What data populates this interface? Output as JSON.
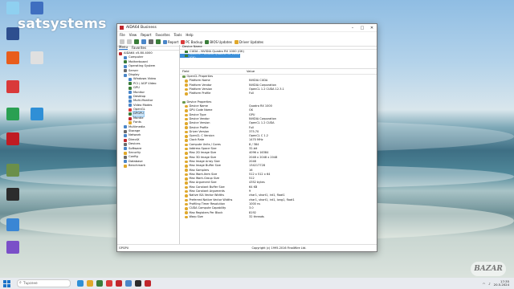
{
  "desktop": {
    "watermark": "satsystems",
    "badge": "BAZAR",
    "icons": [
      {
        "label": "",
        "color": "#8fd0f0"
      },
      {
        "label": "",
        "color": "#3f6fc0"
      },
      {
        "label": "",
        "color": "#2e4f8f"
      },
      {
        "label": "",
        "color": "#e85d1c"
      },
      {
        "label": "",
        "color": "#e0e0e0"
      },
      {
        "label": "",
        "color": "#d93a3a"
      },
      {
        "label": "",
        "color": "#2aa052"
      },
      {
        "label": "",
        "color": "#2f8fd6"
      },
      {
        "label": "",
        "color": "#c01b22"
      },
      {
        "label": "",
        "color": "#6b8f4a"
      },
      {
        "label": "",
        "color": "#2c2c2c"
      },
      {
        "label": "",
        "color": "#3a86d4"
      },
      {
        "label": "",
        "color": "#7a4fc8"
      }
    ]
  },
  "window": {
    "title": "AIDA64 Business",
    "menu": [
      "File",
      "View",
      "Report",
      "Favorites",
      "Tools",
      "Help"
    ],
    "toolbar": {
      "report": "Report",
      "pc_backup": "PC Backup",
      "bios_updates": "BIOS Updates",
      "driver_updates": "Driver Updates"
    },
    "tabs": [
      "Menu",
      "Favorites"
    ],
    "tree": [
      {
        "label": "AIDA64 v5.80.4000",
        "indent": 0,
        "color": "#c0262c"
      },
      {
        "label": "Computer",
        "indent": 1,
        "color": "#4a86c8"
      },
      {
        "label": "Motherboard",
        "indent": 1,
        "color": "#3a7d3a"
      },
      {
        "label": "Operating System",
        "indent": 1,
        "color": "#4a86c8"
      },
      {
        "label": "Server",
        "indent": 1,
        "color": "#6a6a6a"
      },
      {
        "label": "Display",
        "indent": 1,
        "color": "#4a86c8"
      },
      {
        "label": "Windows Video",
        "indent": 2,
        "color": "#4a86c8"
      },
      {
        "label": "PCI / AGP Video",
        "indent": 2,
        "color": "#3a7d3a"
      },
      {
        "label": "GPU",
        "indent": 2,
        "color": "#3a7d3a"
      },
      {
        "label": "Monitor",
        "indent": 2,
        "color": "#4a86c8"
      },
      {
        "label": "Desktop",
        "indent": 2,
        "color": "#4a86c8"
      },
      {
        "label": "Multi-Monitor",
        "indent": 2,
        "color": "#4a86c8"
      },
      {
        "label": "Video Modes",
        "indent": 2,
        "color": "#4a86c8"
      },
      {
        "label": "OpenGL",
        "indent": 2,
        "color": "#d93a3a"
      },
      {
        "label": "GPGPU",
        "indent": 2,
        "color": "#3a7d3a",
        "selected": true
      },
      {
        "label": "Mantle",
        "indent": 2,
        "color": "#c0262c"
      },
      {
        "label": "Fonts",
        "indent": 2,
        "color": "#e0a82b"
      },
      {
        "label": "Multimedia",
        "indent": 1,
        "color": "#4a86c8"
      },
      {
        "label": "Storage",
        "indent": 1,
        "color": "#6a6a6a"
      },
      {
        "label": "Network",
        "indent": 1,
        "color": "#4a86c8"
      },
      {
        "label": "DirectX",
        "indent": 1,
        "color": "#c0262c"
      },
      {
        "label": "Devices",
        "indent": 1,
        "color": "#6a6a6a"
      },
      {
        "label": "Software",
        "indent": 1,
        "color": "#4a86c8"
      },
      {
        "label": "Security",
        "indent": 1,
        "color": "#e0a82b"
      },
      {
        "label": "Config",
        "indent": 1,
        "color": "#6a6a6a"
      },
      {
        "label": "Database",
        "indent": 1,
        "color": "#4a86c8"
      },
      {
        "label": "Benchmark",
        "indent": 1,
        "color": "#e0a82b"
      }
    ],
    "devices_header": "Device Name",
    "devices": [
      {
        "label": "CUDA - NVIDIA Quadro RX 1000 (GK)",
        "selected": false
      },
      {
        "label": "OpenCL - NVIDIA Quadro RX 1000 (GK)",
        "selected": true
      }
    ],
    "table_header": {
      "field": "Field",
      "value": "Value"
    },
    "rows": [
      {
        "field": "OpenCL Properties",
        "value": "",
        "section": true
      },
      {
        "field": "Platform Name",
        "value": "NVIDIA CUDA"
      },
      {
        "field": "Platform Vendor",
        "value": "NVIDIA Corporation"
      },
      {
        "field": "Platform Version",
        "value": "OpenCL 1.2 CUDA 12.3.1"
      },
      {
        "field": "Platform Profile",
        "value": "Full"
      },
      {
        "field": "",
        "value": ""
      },
      {
        "field": "Device Properties",
        "value": "",
        "section": true
      },
      {
        "field": "Device Name",
        "value": "Quadro RX 1000"
      },
      {
        "field": "GPU Code Name",
        "value": "GK"
      },
      {
        "field": "Device Type",
        "value": "GPU"
      },
      {
        "field": "Device Vendor",
        "value": "NVIDIA Corporation"
      },
      {
        "field": "Device Version",
        "value": "OpenCL 1.2 CUDA"
      },
      {
        "field": "Device Profile",
        "value": "Full"
      },
      {
        "field": "Driver Version",
        "value": "375.70"
      },
      {
        "field": "OpenCL C Version",
        "value": "OpenCL C 1.2"
      },
      {
        "field": "Clock Rate",
        "value": "1470 MHz"
      },
      {
        "field": "Compute Units / Cores",
        "value": "8 / 384"
      },
      {
        "field": "Address Space Size",
        "value": "32-bit"
      },
      {
        "field": "Max 2D Image Size",
        "value": "4096 x 16384"
      },
      {
        "field": "Max 3D Image Size",
        "value": "2048 x 2048 x 2048"
      },
      {
        "field": "Max Image Array Size",
        "value": "2048"
      },
      {
        "field": "Max Image Buffer Size",
        "value": "134217728"
      },
      {
        "field": "Max Samplers",
        "value": "16"
      },
      {
        "field": "Max Work-Item Size",
        "value": "512 x 512 x 64"
      },
      {
        "field": "Max Work-Group Size",
        "value": "512"
      },
      {
        "field": "Max Argument Size",
        "value": "4352 bytes"
      },
      {
        "field": "Max Constant Buffer Size",
        "value": "64 KB"
      },
      {
        "field": "Max Constant Arguments",
        "value": "9"
      },
      {
        "field": "Native ISA Vector Widths",
        "value": "char1, short1, int1, float1"
      },
      {
        "field": "Preferred Native Vector Widths",
        "value": "char1, short1, int1, long1, float1"
      },
      {
        "field": "Profiling Timer Resolution",
        "value": "1000 ns"
      },
      {
        "field": "CUDA Compute Capability",
        "value": "3.0"
      },
      {
        "field": "Max Registers Per Block",
        "value": "8192"
      },
      {
        "field": "Warp Size",
        "value": "32 threads"
      }
    ],
    "status": {
      "left": "GPGPU",
      "copyright": "Copyright (c) 1995-2016 FinalWire Ltd."
    }
  },
  "taskbar": {
    "search_placeholder": "Търсене",
    "apps": [
      "#2f8fd6",
      "#e0a82b",
      "#3a7d3a",
      "#d93a3a",
      "#c0262c",
      "#4a86c8",
      "#2c2c2c",
      "#c0262c"
    ],
    "time": "17:35",
    "date": "20.5.2024"
  }
}
